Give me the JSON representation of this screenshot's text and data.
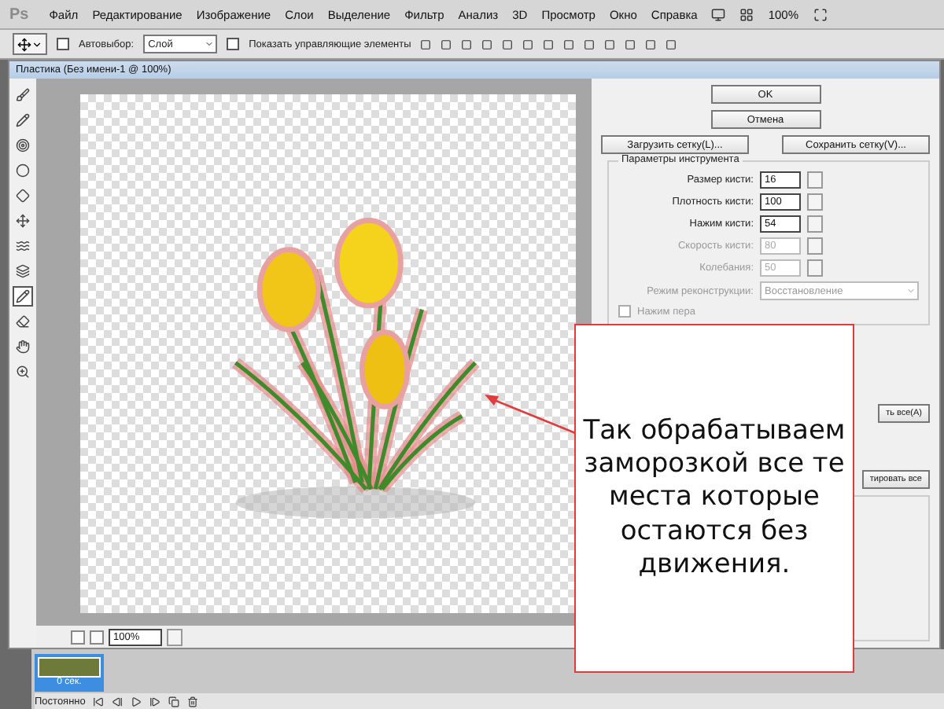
{
  "app_logo": "Ps",
  "menu": [
    "Файл",
    "Редактирование",
    "Изображение",
    "Слои",
    "Выделение",
    "Фильтр",
    "Анализ",
    "3D",
    "Просмотр",
    "Окно",
    "Справка"
  ],
  "menu_zoom": "100%",
  "options_bar": {
    "auto_select": {
      "label": "Автовыбор:",
      "checked": false
    },
    "auto_select_target": "Слой",
    "show_controls": {
      "label": "Показать управляющие элементы",
      "checked": false
    }
  },
  "dialog": {
    "title": "Пластика (Без имени-1 @ 100%)",
    "tools": [
      {
        "selected": false
      },
      {
        "selected": false
      },
      {
        "selected": false
      },
      {
        "selected": false
      },
      {
        "selected": false
      },
      {
        "selected": false
      },
      {
        "selected": false
      },
      {
        "selected": false
      },
      {
        "selected": true
      },
      {
        "selected": false
      },
      {
        "selected": false
      },
      {
        "selected": false
      }
    ],
    "zoom": "100%",
    "buttons": [
      "OK",
      "Отмена"
    ],
    "mesh_buttons": [
      "Загрузить сетку(L)...",
      "Сохранить сетку(V)..."
    ],
    "tool_options": {
      "title": "Параметры инструмента",
      "fields": [
        {
          "label": "Размер кисти:",
          "value": "16",
          "disabled": false
        },
        {
          "label": "Плотность кисти:",
          "value": "100",
          "disabled": false
        },
        {
          "label": "Нажим кисти:",
          "value": "54",
          "disabled": false
        },
        {
          "label": "Скорость кисти:",
          "value": "80",
          "disabled": true
        },
        {
          "label": "Колебания:",
          "value": "50",
          "disabled": true
        }
      ],
      "mode": {
        "label": "Режим реконструкции:",
        "value": "Восстановление",
        "disabled": true
      },
      "pen_pressure": {
        "label": "Нажим пера",
        "checked": false,
        "disabled": true
      }
    },
    "partial_buttons": [
      "ть все(A)",
      "тировать все"
    ]
  },
  "timeline": {
    "frame_time": "0 сек.",
    "frame_selected": true,
    "loop": "Постоянно"
  },
  "callout": "Так обрабатываем заморозкой все те места которые остаются без движения."
}
